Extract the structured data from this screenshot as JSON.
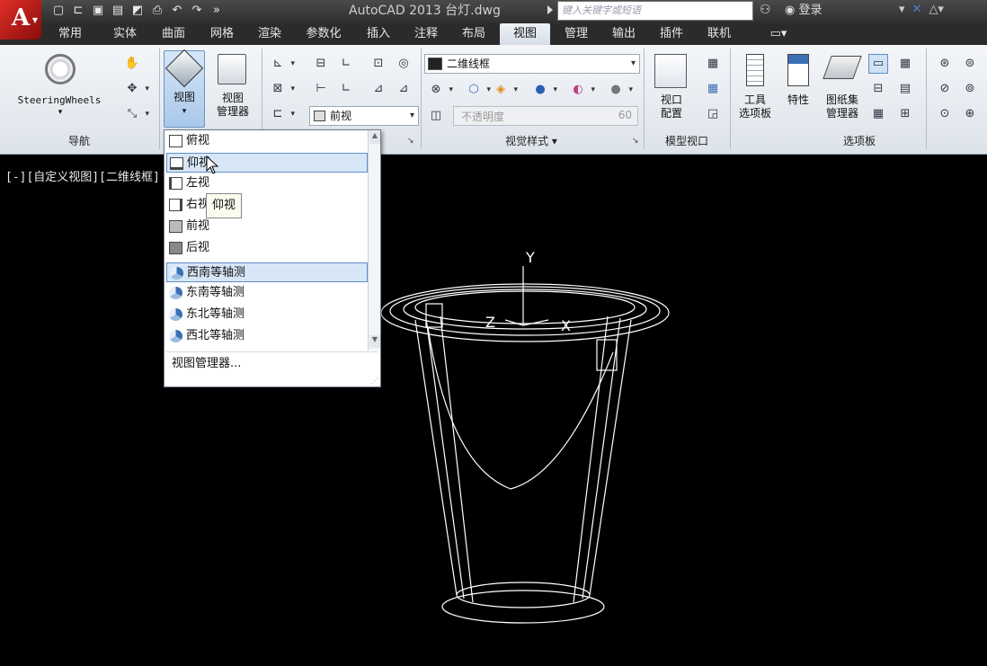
{
  "title_bar": {
    "app_logo": "A",
    "qat_icons": [
      "new-icon",
      "open-icon",
      "save-icon",
      "save-as-icon",
      "plot-icon",
      "print-icon",
      "undo-icon",
      "redo-icon"
    ],
    "window_title": "AutoCAD 2013   台灯.dwg",
    "search_placeholder": "键入关键字或短语",
    "login_label": "登录"
  },
  "ribbon_tabs": [
    "常用",
    "实体",
    "曲面",
    "网格",
    "渲染",
    "参数化",
    "插入",
    "注释",
    "布局",
    "视图",
    "管理",
    "输出",
    "插件",
    "联机"
  ],
  "active_tab": "视图",
  "ribbon": {
    "navigation": {
      "steeringwheels_label": "SteeringWheels",
      "panel_label": "导航"
    },
    "views": {
      "view_label": "视图",
      "view_manager_label": "视图\n管理器",
      "current_view": "前视"
    },
    "visual_styles": {
      "current_style": "二维线框",
      "opacity_label": "不透明度",
      "opacity_value": "60",
      "panel_label": "视觉样式 ▾"
    },
    "model_viewports": {
      "viewport_config_label": "视口\n配置",
      "panel_label": "模型视口"
    },
    "palettes": {
      "tool_palettes_label": "工具\n选项板",
      "properties_label": "特性",
      "sheet_set_label": "图纸集\n管理器",
      "panel_label": "选项板"
    }
  },
  "viewport": {
    "label": "[-][自定义视图][二维线框]",
    "axis_y": "Y",
    "axis_z": "Z",
    "axis_x": "X"
  },
  "view_dropdown": {
    "items": [
      {
        "label": "俯视",
        "icon": "top-view-icon"
      },
      {
        "label": "仰视",
        "icon": "bottom-view-icon"
      },
      {
        "label": "左视",
        "icon": "left-view-icon"
      },
      {
        "label": "右视",
        "icon": "right-view-icon"
      },
      {
        "label": "前视",
        "icon": "front-view-icon"
      },
      {
        "label": "后视",
        "icon": "back-view-icon"
      },
      {
        "label": "西南等轴测",
        "icon": "sw-isometric-icon"
      },
      {
        "label": "东南等轴测",
        "icon": "se-isometric-icon"
      },
      {
        "label": "东北等轴测",
        "icon": "ne-isometric-icon"
      },
      {
        "label": "西北等轴测",
        "icon": "nw-isometric-icon"
      }
    ],
    "hovered_index": 1,
    "current_index": 6,
    "manager_label": "视图管理器...",
    "tooltip": "仰视"
  }
}
